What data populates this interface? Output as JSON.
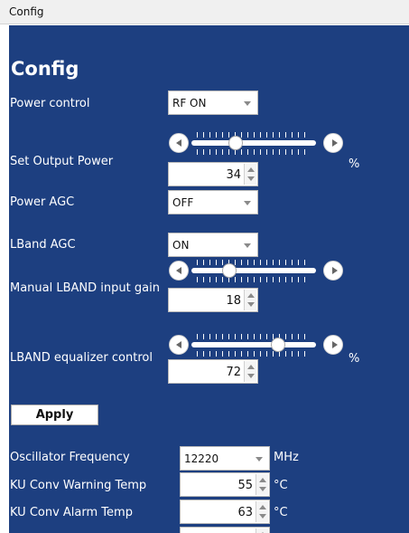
{
  "window": {
    "tab_title": "Config"
  },
  "panel": {
    "heading": "Config"
  },
  "power_control": {
    "label": "Power control",
    "value": "RF ON"
  },
  "output_power": {
    "label": "Set Output Power",
    "value": "34",
    "unit": "%",
    "slider_fraction": 0.34
  },
  "power_agc": {
    "label": "Power AGC",
    "value": "OFF"
  },
  "lband_agc": {
    "label": "LBand AGC",
    "value": "ON"
  },
  "lband_gain": {
    "label": "Manual LBAND input gain",
    "value": "18",
    "slider_fraction": 0.28
  },
  "lband_eq": {
    "label": "LBAND equalizer control",
    "value": "72",
    "unit": "%",
    "slider_fraction": 0.72
  },
  "apply": {
    "label": "Apply"
  },
  "oscillator": {
    "label": "Oscillator Frequency",
    "value": "12220",
    "unit": "MHz"
  },
  "warn_temp": {
    "label": "KU Conv Warning Temp",
    "value": "55",
    "unit": "°C"
  },
  "alarm_temp": {
    "label": "KU Conv Alarm Temp",
    "value": "63",
    "unit": "°C"
  },
  "colors": {
    "panel_bg": "#1d3f80",
    "tab_bg": "#f0f0f0"
  }
}
